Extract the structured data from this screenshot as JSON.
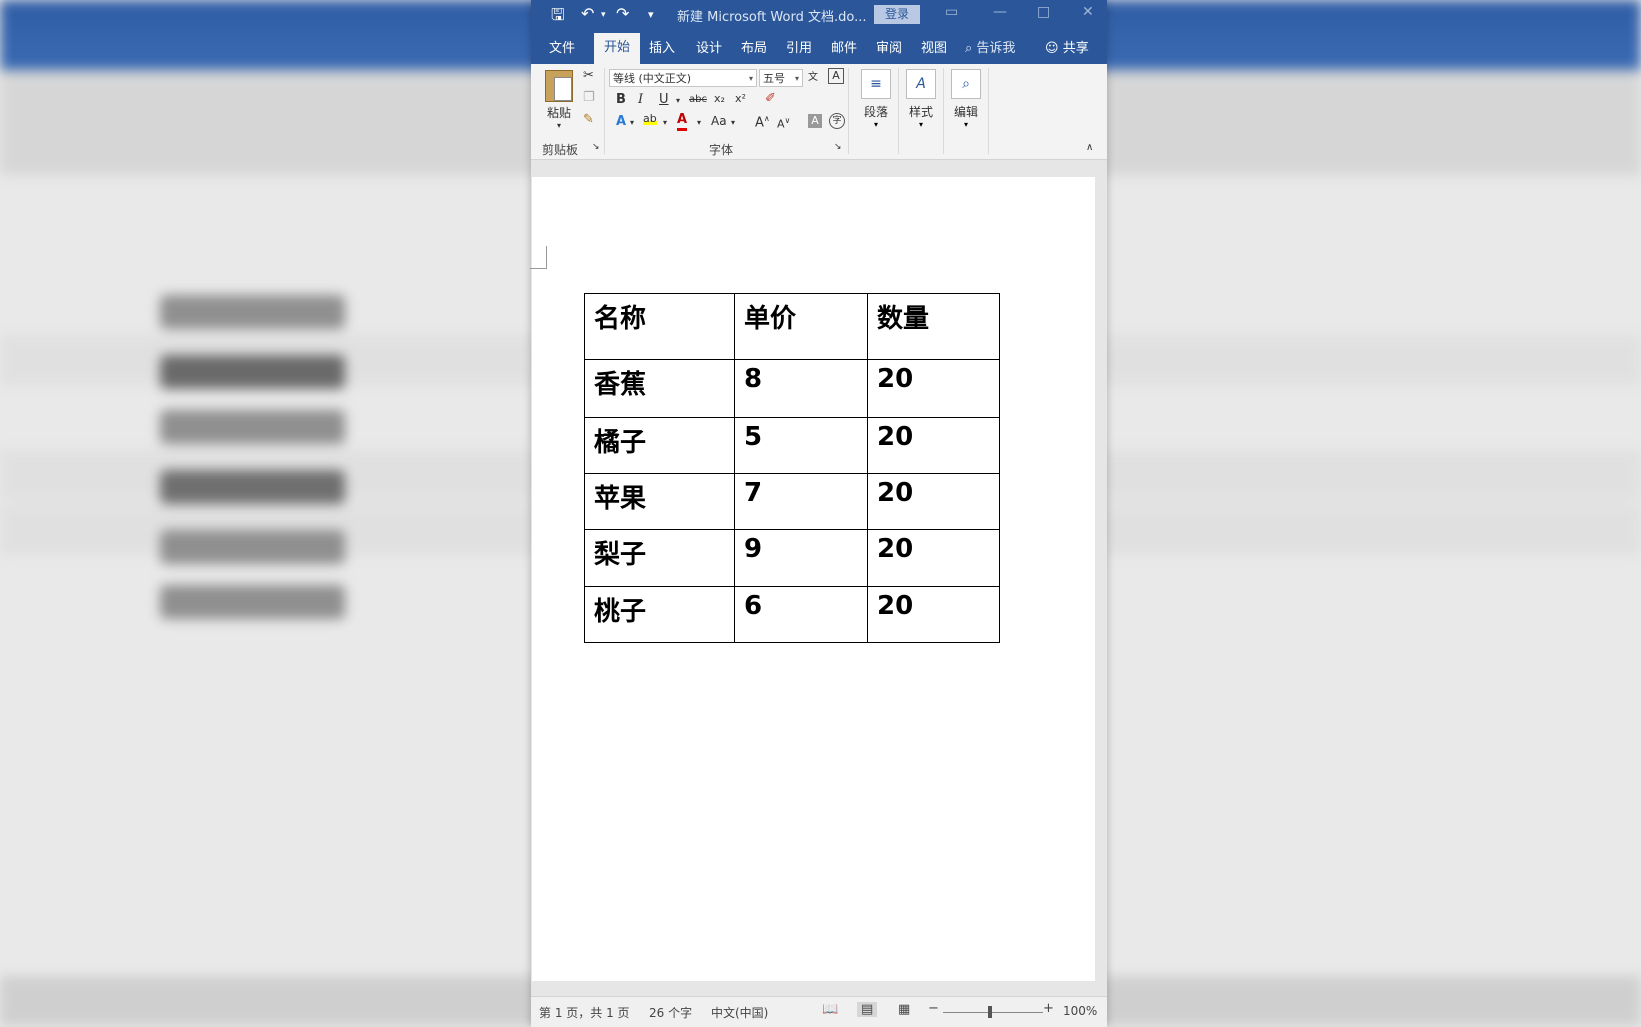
{
  "title_bar": {
    "doc_title": "新建 Microsoft Word 文档.do...",
    "login_label": "登录"
  },
  "tabs": [
    "文件",
    "开始",
    "插入",
    "设计",
    "布局",
    "引用",
    "邮件",
    "审阅",
    "视图"
  ],
  "tell_me": "告诉我",
  "share": "共享",
  "ribbon": {
    "clipboard": {
      "paste_label": "粘贴",
      "group_label": "剪贴板"
    },
    "font": {
      "font_name": "等线 (中文正文)",
      "font_size": "五号",
      "bold": "B",
      "italic": "I",
      "underline": "U",
      "strike": "abc",
      "subscript": "x₂",
      "superscript": "x²",
      "change_case": "Aa",
      "group_label": "字体"
    },
    "paragraph_label": "段落",
    "styles_label": "样式",
    "editing_label": "编辑"
  },
  "table": {
    "headers": [
      "名称",
      "单价",
      "数量"
    ],
    "rows": [
      [
        "香蕉",
        "8",
        "20"
      ],
      [
        "橘子",
        "5",
        "20"
      ],
      [
        "苹果",
        "7",
        "20"
      ],
      [
        "梨子",
        "9",
        "20"
      ],
      [
        "桃子",
        "6",
        "20"
      ]
    ]
  },
  "status_bar": {
    "page_info": "第 1 页，共 1 页",
    "word_count": "26 个字",
    "language": "中文(中国)",
    "zoom": "100%"
  },
  "colors": {
    "word_blue": "#2b579a",
    "ribbon_bg": "#f3f3f3"
  }
}
